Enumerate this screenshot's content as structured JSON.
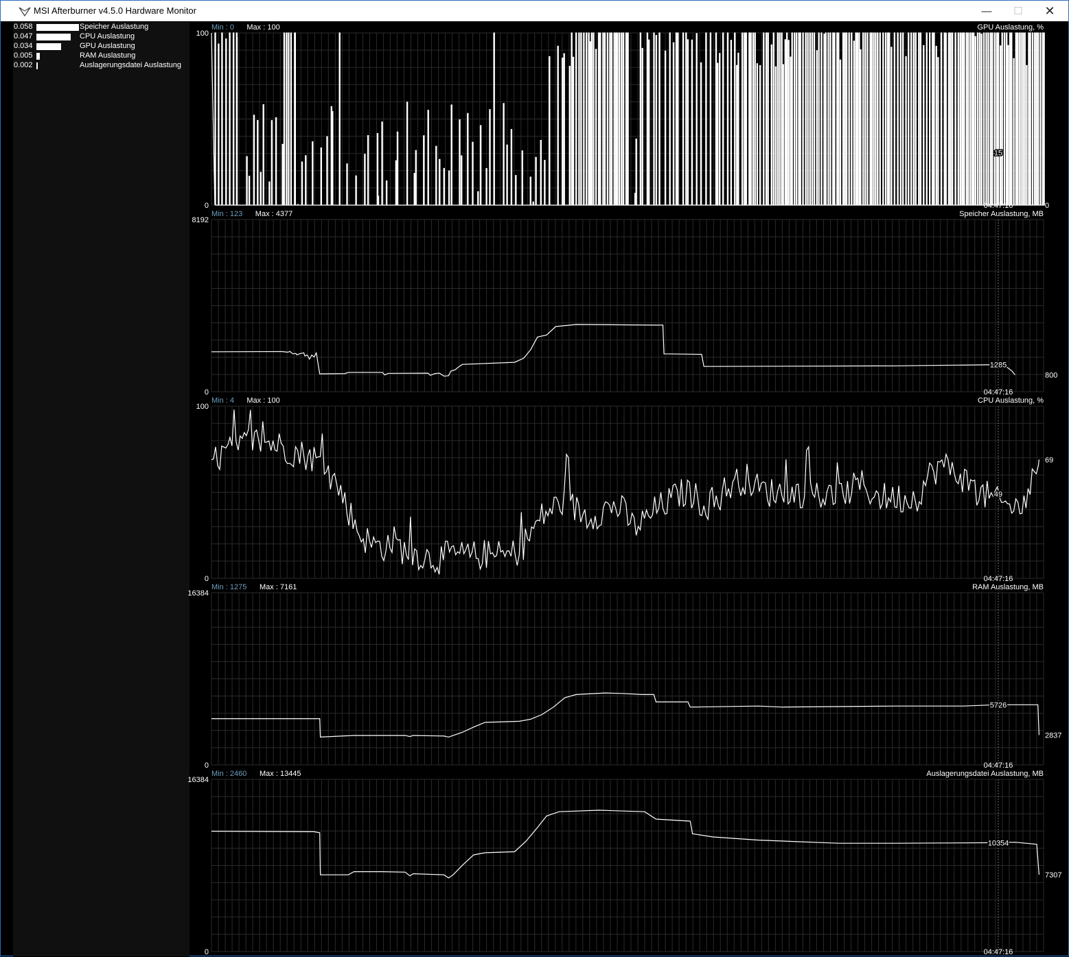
{
  "window": {
    "title": "MSI Afterburner v4.5.0 Hardware Monitor",
    "icon": "afterburner-logo-icon",
    "controls": {
      "minimize": "—",
      "maximize": "☐",
      "close": "✕"
    }
  },
  "colors": {
    "background": "#000000",
    "sidebar": "#101010",
    "grid": "#2b2b2b",
    "trace": "#ffffff",
    "min_label": "#6f9fc0",
    "window_border": "#2b6cbf"
  },
  "sidebar": {
    "items": [
      {
        "value": "0.058",
        "label": "Speicher Auslastung",
        "level": 0.058
      },
      {
        "value": "0.047",
        "label": "CPU Auslastung",
        "level": 0.047
      },
      {
        "value": "0.034",
        "label": "GPU Auslastung",
        "level": 0.034
      },
      {
        "value": "0.005",
        "label": "RAM Auslastung",
        "level": 0.005
      },
      {
        "value": "0.002",
        "label": "Auslagerungsdatei Auslastung",
        "level": 0.002
      }
    ]
  },
  "chart_data": [
    {
      "type": "line",
      "title": "GPU Auslastung, %",
      "min_label": "Min : 0",
      "max_label": "Max : 100",
      "y_top_label": "100",
      "y_bottom_label": "0",
      "ylim": [
        0,
        100
      ],
      "current_label": "0",
      "current_value": 0,
      "marker_label": "15",
      "marker_value": 15,
      "time_label": "04:47:16",
      "style": "square-wave",
      "bursts": [
        [
          0,
          0.3,
          0.7
        ],
        [
          0.3,
          0.45,
          0.0
        ],
        [
          0.45,
          0.55,
          0.12
        ],
        [
          0.55,
          0.62,
          0.0
        ],
        [
          0.62,
          0.72,
          0.05
        ],
        [
          0.72,
          0.85,
          0.08
        ],
        [
          0.85,
          1.0,
          0.75
        ],
        [
          1.0,
          1.45,
          0.0
        ],
        [
          1.45,
          2.0,
          0.08
        ],
        [
          2.0,
          2.6,
          0.02
        ],
        [
          2.6,
          3.0,
          0.06
        ],
        [
          3.0,
          3.3,
          0.0
        ],
        [
          3.3,
          3.6,
          0.1
        ],
        [
          3.6,
          4.0,
          0.04
        ],
        [
          4.0,
          4.3,
          0.25
        ],
        [
          4.3,
          5.0,
          0.85
        ],
        [
          5.0,
          5.1,
          0.1
        ],
        [
          5.1,
          6.2,
          0.55
        ],
        [
          6.2,
          6.8,
          0.7
        ],
        [
          6.8,
          8.0,
          0.85
        ],
        [
          8.0,
          9.0,
          0.8
        ],
        [
          9.0,
          10.0,
          0.9
        ]
      ]
    },
    {
      "type": "line",
      "title": "Speicher Auslastung, MB",
      "min_label": "Min : 123",
      "max_label": "Max : 4377",
      "y_top_label": "8192",
      "y_bottom_label": "0",
      "ylim": [
        0,
        8192
      ],
      "current_label": "800",
      "current_value": 800,
      "marker_label": "1285",
      "marker_value": 1285,
      "time_label": "04:47:16",
      "style": "step",
      "points": [
        [
          0,
          1900
        ],
        [
          6.2,
          1910
        ],
        [
          6.7,
          1880
        ],
        [
          6.9,
          1920
        ],
        [
          7.0,
          1850
        ],
        [
          7.2,
          1800
        ],
        [
          7.4,
          1820
        ],
        [
          7.5,
          1750
        ],
        [
          7.7,
          1800
        ],
        [
          8.1,
          1850
        ],
        [
          8.2,
          1700
        ],
        [
          8.4,
          1750
        ],
        [
          8.6,
          1550
        ],
        [
          8.8,
          1750
        ],
        [
          9.0,
          1650
        ],
        [
          9.2,
          1850
        ],
        [
          9.5,
          850
        ],
        [
          11.7,
          860
        ],
        [
          12.0,
          920
        ],
        [
          15.0,
          920
        ],
        [
          15.2,
          800
        ],
        [
          15.5,
          870
        ],
        [
          19.0,
          880
        ],
        [
          19.2,
          780
        ],
        [
          19.6,
          860
        ],
        [
          20.0,
          880
        ],
        [
          20.4,
          740
        ],
        [
          20.8,
          760
        ],
        [
          21.0,
          980
        ],
        [
          21.4,
          1050
        ],
        [
          21.6,
          1150
        ],
        [
          22.0,
          1300
        ],
        [
          26.6,
          1400
        ],
        [
          27.4,
          1600
        ],
        [
          28.0,
          2000
        ],
        [
          28.6,
          2600
        ],
        [
          29.4,
          2700
        ],
        [
          30.2,
          3100
        ],
        [
          32.0,
          3200
        ],
        [
          38.8,
          3170
        ],
        [
          39.6,
          3170
        ],
        [
          39.7,
          1800
        ],
        [
          43.0,
          1780
        ],
        [
          43.2,
          1200
        ],
        [
          60.0,
          1230
        ],
        [
          68.8,
          1285
        ],
        [
          69.2,
          1285
        ],
        [
          69.5,
          1150
        ],
        [
          69.7,
          1200
        ],
        [
          70.2,
          1000
        ],
        [
          70.5,
          800
        ]
      ]
    },
    {
      "type": "line",
      "title": "CPU Auslastung, %",
      "min_label": "Min : 4",
      "max_label": "Max : 100",
      "y_top_label": "100",
      "y_bottom_label": "0",
      "ylim": [
        0,
        100
      ],
      "current_label": "69",
      "current_value": 69,
      "marker_label": "49",
      "marker_value": 49,
      "time_label": "04:47:16",
      "style": "noisy",
      "points": [
        [
          0,
          68
        ],
        [
          1.0,
          72
        ],
        [
          2.0,
          75
        ],
        [
          3.0,
          78
        ],
        [
          4.0,
          80
        ],
        [
          5.0,
          79
        ],
        [
          6.0,
          77
        ],
        [
          7.0,
          74
        ],
        [
          8.0,
          72
        ],
        [
          9.0,
          70
        ],
        [
          10.0,
          63
        ],
        [
          11.0,
          55
        ],
        [
          12.0,
          40
        ],
        [
          13.0,
          26
        ],
        [
          14.0,
          20
        ],
        [
          15.0,
          18
        ],
        [
          16.0,
          22
        ],
        [
          17.0,
          15
        ],
        [
          18.0,
          14
        ],
        [
          19.0,
          12
        ],
        [
          20.0,
          11
        ],
        [
          21.0,
          14
        ],
        [
          22.0,
          13
        ],
        [
          23.0,
          13
        ],
        [
          24.0,
          14
        ],
        [
          25.0,
          13
        ],
        [
          26.0,
          13
        ],
        [
          27.0,
          16
        ],
        [
          28.0,
          26
        ],
        [
          29.0,
          36
        ],
        [
          30.0,
          41
        ],
        [
          31.0,
          45
        ],
        [
          32.0,
          40
        ],
        [
          33.0,
          36
        ],
        [
          34.0,
          38
        ],
        [
          35.0,
          42
        ],
        [
          36.0,
          40
        ],
        [
          37.0,
          30
        ],
        [
          38.0,
          33
        ],
        [
          39.0,
          40
        ],
        [
          40.0,
          44
        ],
        [
          41.0,
          49
        ],
        [
          42.0,
          50
        ],
        [
          43.0,
          44
        ],
        [
          44.0,
          42
        ],
        [
          45.0,
          51
        ],
        [
          46.0,
          56
        ],
        [
          47.0,
          58
        ],
        [
          48.0,
          52
        ],
        [
          49.0,
          50
        ],
        [
          50.0,
          50
        ],
        [
          51.0,
          49
        ],
        [
          52.0,
          50
        ],
        [
          53.0,
          48
        ],
        [
          54.0,
          48
        ],
        [
          55.0,
          47
        ],
        [
          56.0,
          51
        ],
        [
          57.0,
          55
        ],
        [
          58.0,
          49
        ],
        [
          59.0,
          47
        ],
        [
          60.0,
          47
        ],
        [
          61.0,
          46
        ],
        [
          62.0,
          48
        ],
        [
          63.0,
          60
        ],
        [
          64.0,
          66
        ],
        [
          65.0,
          63
        ],
        [
          66.0,
          58
        ],
        [
          67.0,
          50
        ],
        [
          68.0,
          48
        ],
        [
          69.0,
          44
        ],
        [
          70.0,
          42
        ],
        [
          71.0,
          40
        ],
        [
          72.0,
          56
        ],
        [
          72.6,
          69
        ]
      ]
    },
    {
      "type": "line",
      "title": "RAM Auslastung, MB",
      "min_label": "Min : 1275",
      "max_label": "Max : 7161",
      "y_top_label": "16384",
      "y_bottom_label": "0",
      "ylim": [
        0,
        16384
      ],
      "current_label": "2837",
      "current_value": 2837,
      "marker_label": "5726",
      "marker_value": 5726,
      "time_label": "04:47:16",
      "style": "step",
      "points": [
        [
          0,
          4400
        ],
        [
          9.5,
          4400
        ],
        [
          9.55,
          2650
        ],
        [
          12.5,
          2800
        ],
        [
          17.0,
          2800
        ],
        [
          17.4,
          2700
        ],
        [
          17.7,
          2800
        ],
        [
          20.4,
          2750
        ],
        [
          20.8,
          2650
        ],
        [
          21.2,
          2800
        ],
        [
          22.0,
          3100
        ],
        [
          23.0,
          3600
        ],
        [
          24.0,
          4050
        ],
        [
          27.0,
          4150
        ],
        [
          28.0,
          4350
        ],
        [
          29.0,
          4800
        ],
        [
          30.0,
          5500
        ],
        [
          31.0,
          6400
        ],
        [
          32.0,
          6700
        ],
        [
          34.5,
          6850
        ],
        [
          36.0,
          6800
        ],
        [
          37.8,
          6700
        ],
        [
          38.8,
          6700
        ],
        [
          39.0,
          6000
        ],
        [
          41.8,
          6000
        ],
        [
          42.0,
          5500
        ],
        [
          48.0,
          5600
        ],
        [
          50.0,
          5500
        ],
        [
          60.0,
          5600
        ],
        [
          66.0,
          5600
        ],
        [
          68.8,
          5726
        ],
        [
          70.5,
          5726
        ],
        [
          72.5,
          5726
        ],
        [
          72.6,
          2837
        ]
      ]
    },
    {
      "type": "line",
      "title": "Auslagerungsdatei Auslastung, MB",
      "min_label": "Min : 2460",
      "max_label": "Max : 13445",
      "y_top_label": "16384",
      "y_bottom_label": "0",
      "ylim": [
        0,
        16384
      ],
      "current_label": "7307",
      "current_value": 7307,
      "marker_label": "10354",
      "marker_value": 10354,
      "time_label": "04:47:16",
      "style": "step",
      "points": [
        [
          0,
          11450
        ],
        [
          9.0,
          11400
        ],
        [
          9.5,
          11300
        ],
        [
          9.55,
          7300
        ],
        [
          12.0,
          7300
        ],
        [
          12.5,
          7600
        ],
        [
          15.0,
          7600
        ],
        [
          17.0,
          7550
        ],
        [
          17.4,
          7200
        ],
        [
          17.7,
          7400
        ],
        [
          20.4,
          7300
        ],
        [
          20.8,
          7000
        ],
        [
          21.2,
          7300
        ],
        [
          22.0,
          8200
        ],
        [
          23.0,
          9200
        ],
        [
          24.0,
          9400
        ],
        [
          26.6,
          9500
        ],
        [
          27.6,
          10500
        ],
        [
          28.6,
          11800
        ],
        [
          29.4,
          12900
        ],
        [
          30.5,
          13300
        ],
        [
          34.0,
          13445
        ],
        [
          38.0,
          13300
        ],
        [
          39.0,
          12600
        ],
        [
          42.0,
          12400
        ],
        [
          42.2,
          11200
        ],
        [
          44.0,
          10900
        ],
        [
          48.0,
          10600
        ],
        [
          55.0,
          10300
        ],
        [
          60.0,
          10300
        ],
        [
          68.8,
          10354
        ],
        [
          70.5,
          10400
        ],
        [
          72.4,
          10200
        ],
        [
          72.6,
          7307
        ]
      ]
    }
  ]
}
